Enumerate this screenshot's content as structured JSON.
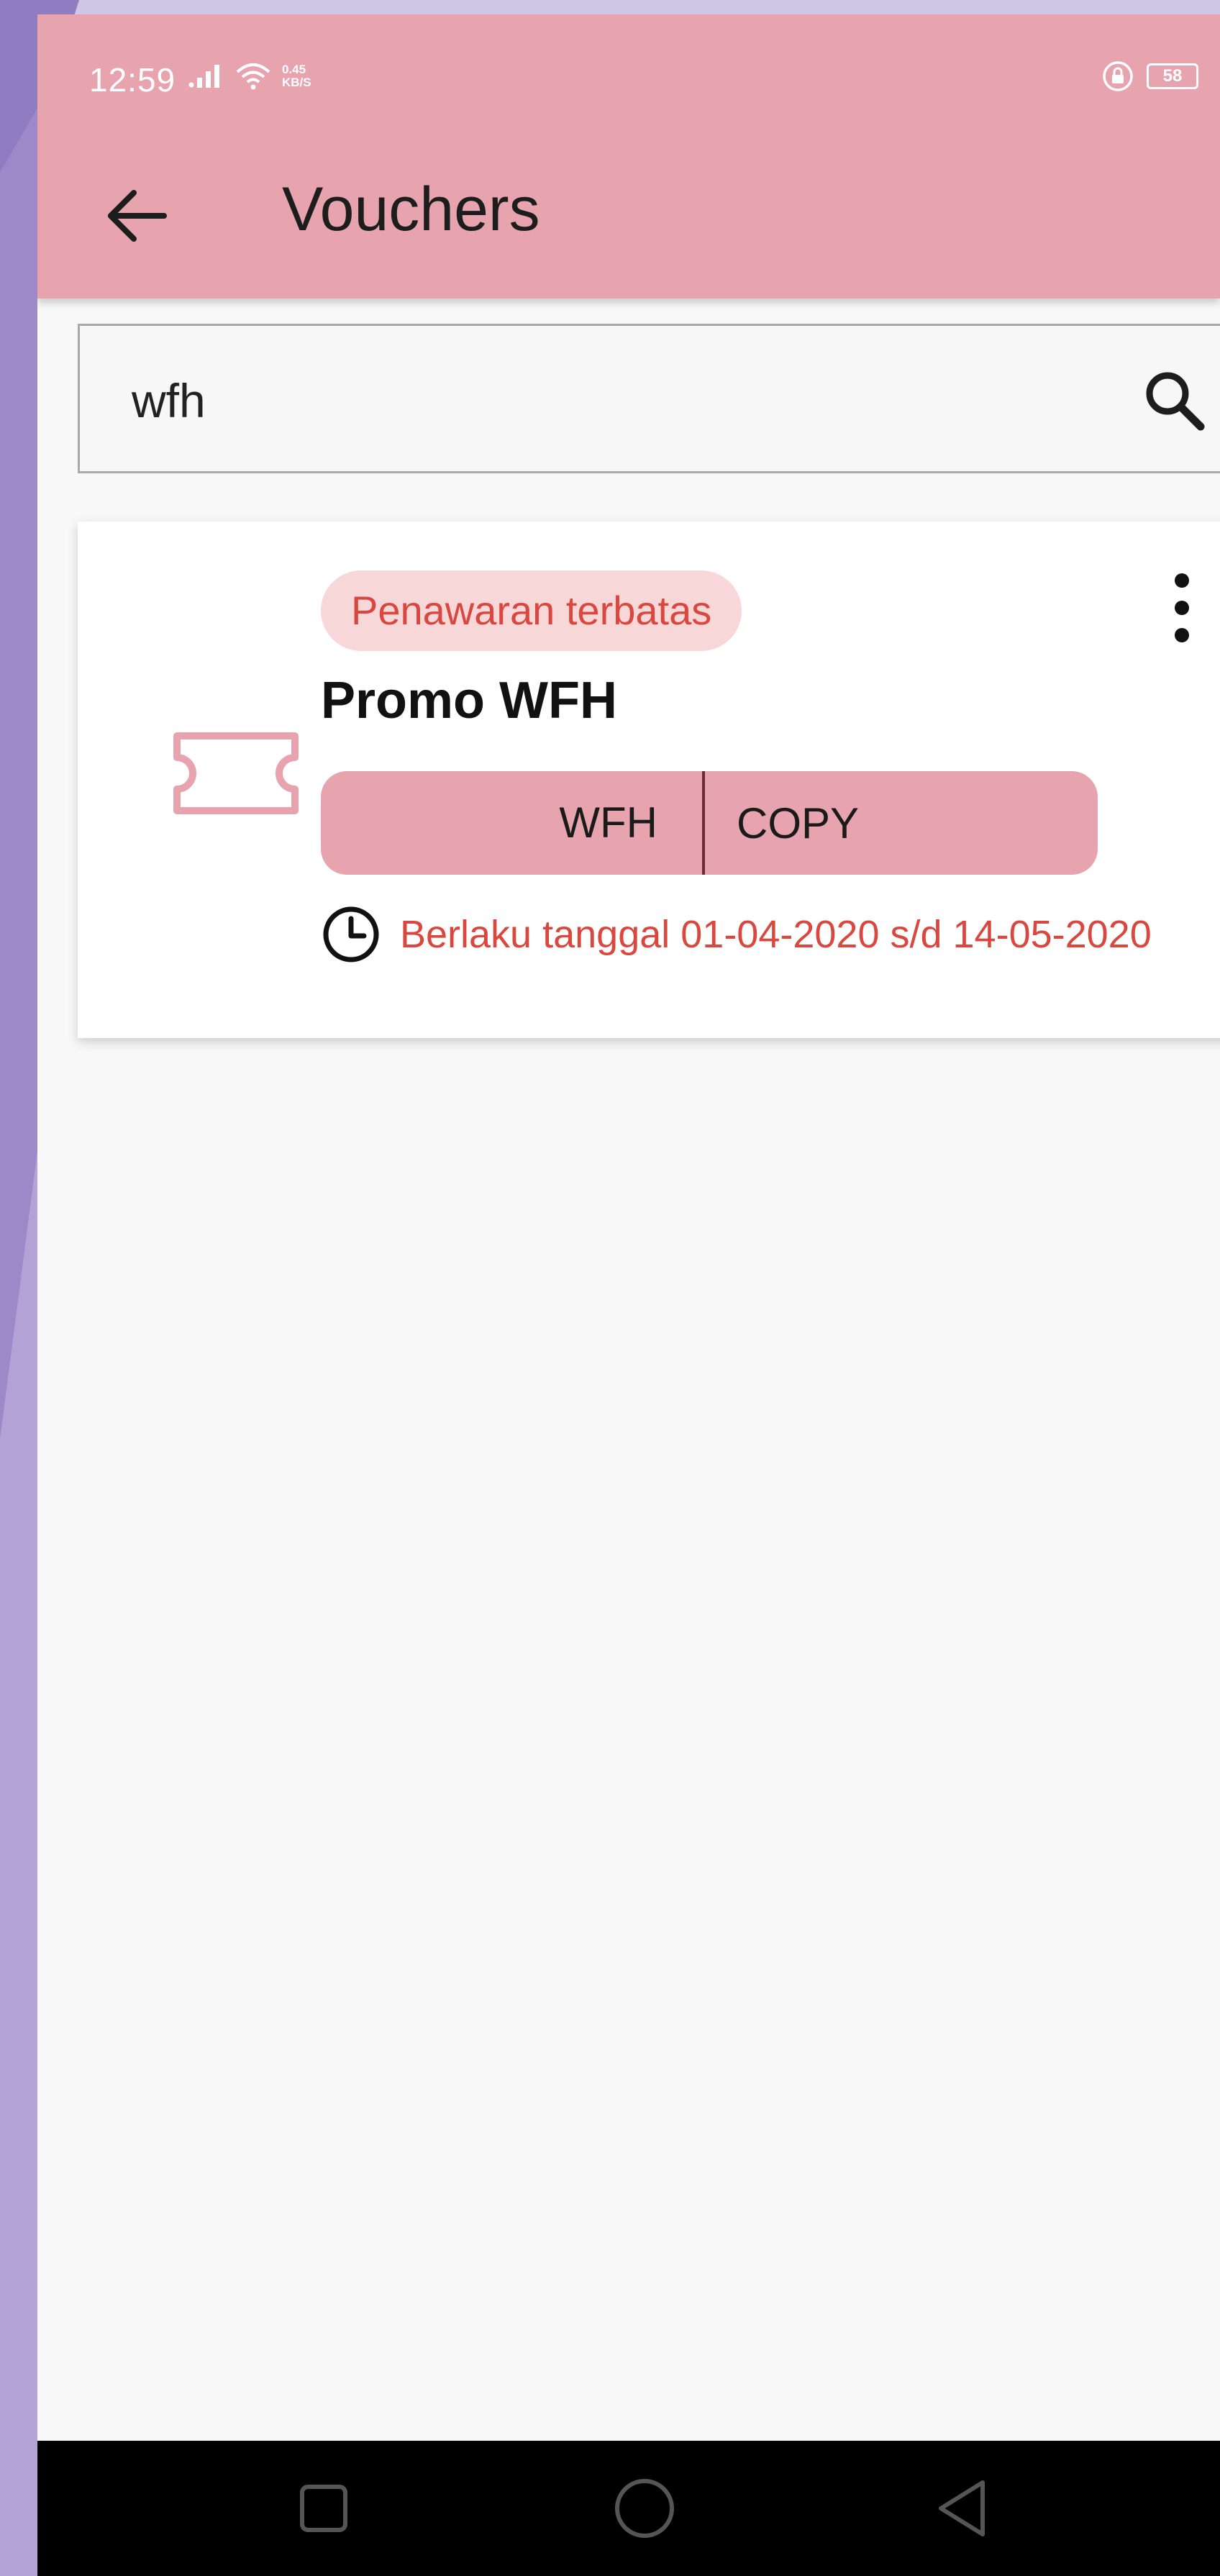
{
  "status_bar": {
    "time": "12:59",
    "speed_value": "0.45",
    "speed_unit": "KB/S",
    "battery": "58"
  },
  "app_bar": {
    "title": "Vouchers"
  },
  "search": {
    "value": "wfh",
    "placeholder": ""
  },
  "voucher": {
    "badge": "Penawaran terbatas",
    "title": "Promo WFH",
    "code": "WFH",
    "copy_label": "COPY",
    "validity": "Berlaku tanggal 01-04-2020 s/d 14-05-2020"
  },
  "colors": {
    "accent": "#e7a4af",
    "badge_bg": "#f7d7d8",
    "badge_text": "#d9473f",
    "background": "#f8f8f8"
  },
  "icons": {
    "back": "arrow-left-icon",
    "search": "search-icon",
    "more": "more-vertical-icon",
    "ticket": "ticket-icon",
    "clock": "clock-icon",
    "nav_recent": "square-icon",
    "nav_home": "circle-icon",
    "nav_back": "triangle-back-icon"
  }
}
